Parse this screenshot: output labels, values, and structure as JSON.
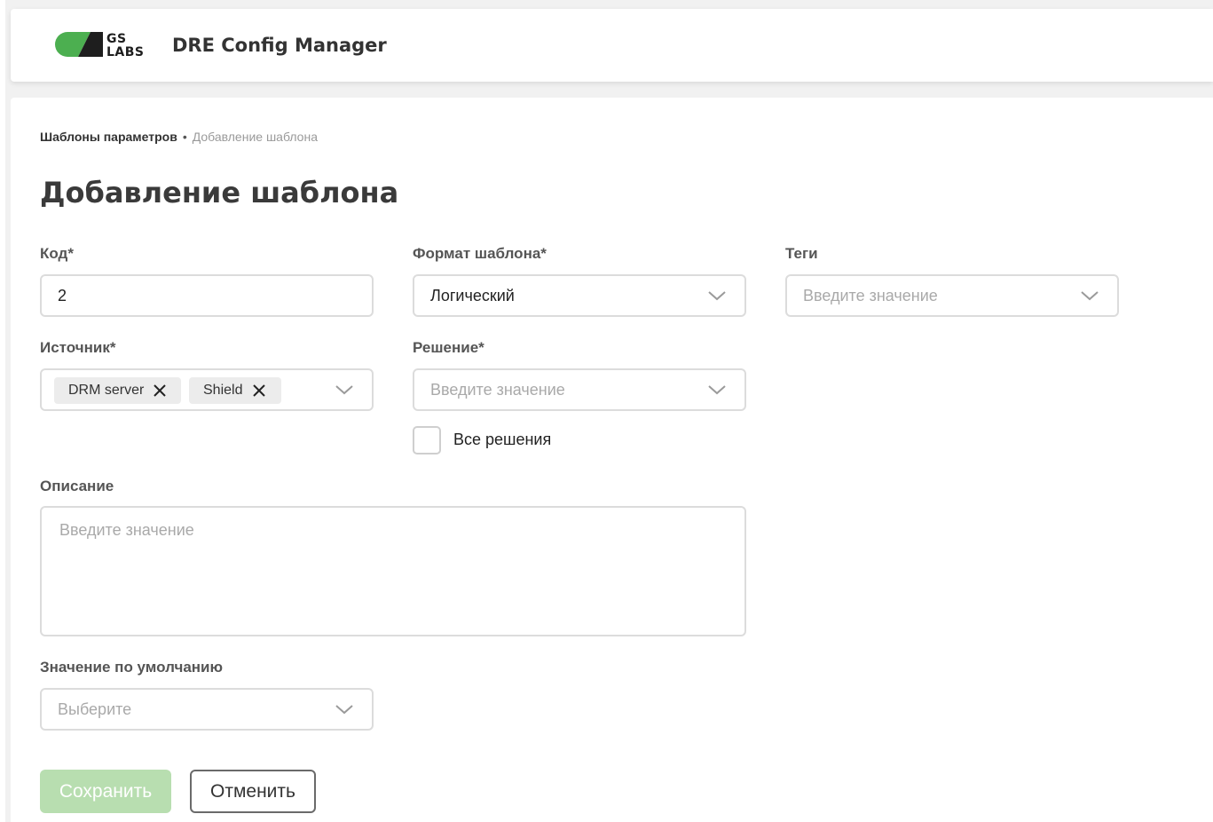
{
  "header": {
    "logo_line1": "GS",
    "logo_line2": "LABS",
    "app_title": "DRE Config Manager",
    "brand_green": "#4caf50"
  },
  "breadcrumb": {
    "parent": "Шаблоны параметров",
    "separator": "•",
    "current": "Добавление шаблона"
  },
  "page": {
    "title": "Добавление шаблона"
  },
  "form": {
    "code": {
      "label": "Код*",
      "value": "2"
    },
    "template_format": {
      "label": "Формат шаблона*",
      "value": "Логический"
    },
    "tags": {
      "label": "Теги",
      "placeholder": "Введите значение"
    },
    "source": {
      "label": "Источник*",
      "chips": [
        "DRM server",
        "Shield"
      ]
    },
    "solution": {
      "label": "Решение*",
      "placeholder": "Введите значение"
    },
    "all_solutions": {
      "label": "Все решения",
      "checked": false
    },
    "description": {
      "label": "Описание",
      "placeholder": "Введите значение"
    },
    "default_value": {
      "label": "Значение по умолчанию",
      "placeholder": "Выберите"
    }
  },
  "actions": {
    "save_label": "Сохранить",
    "cancel_label": "Отменить",
    "save_color": "#b8deb0"
  }
}
